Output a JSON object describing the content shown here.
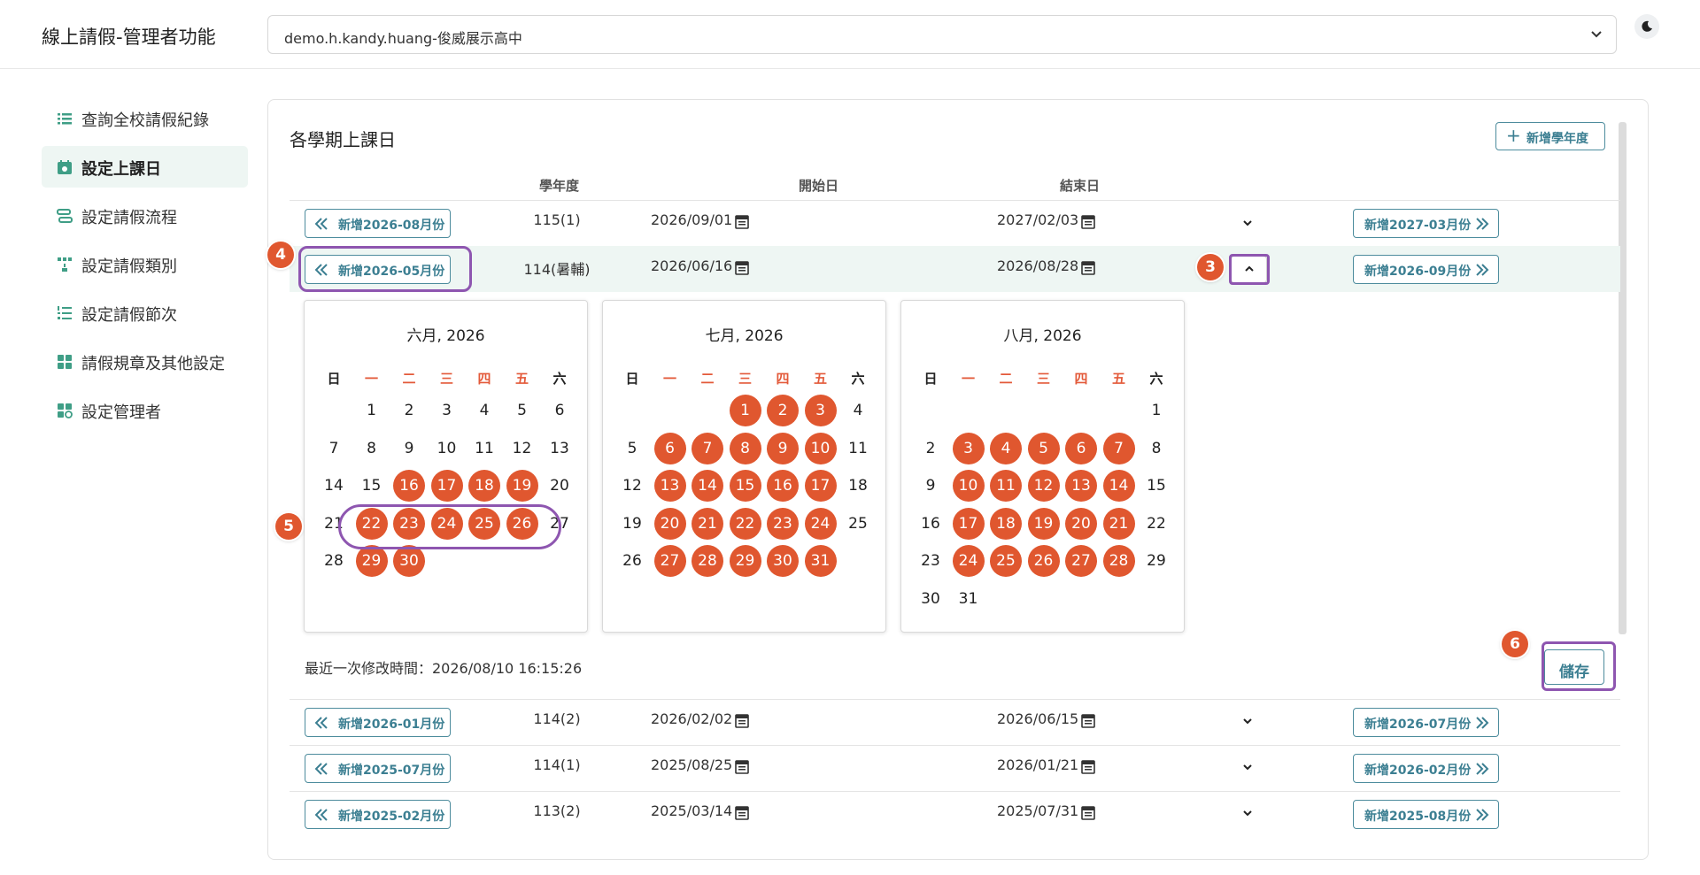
{
  "header": {
    "app_title": "線上請假-管理者功能",
    "school_selected": "demo.h.kandy.huang-俊威展示高中"
  },
  "sidebar": {
    "items": [
      {
        "label": "查詢全校請假紀錄",
        "icon": "list-icon"
      },
      {
        "label": "設定上課日",
        "icon": "calendar-icon",
        "active": true
      },
      {
        "label": "設定請假流程",
        "icon": "flow-icon"
      },
      {
        "label": "設定請假類別",
        "icon": "category-icon"
      },
      {
        "label": "設定請假節次",
        "icon": "numbered-list-icon"
      },
      {
        "label": "請假規章及其他設定",
        "icon": "grid-icon"
      },
      {
        "label": "設定管理者",
        "icon": "admin-icon"
      }
    ]
  },
  "main": {
    "title": "各學期上課日",
    "add_year_label": "新增學年度",
    "columns": [
      "學年度",
      "開始日",
      "結束日"
    ],
    "rows": [
      {
        "prev": "新增2026-08月份",
        "year": "115(1)",
        "start": "2026/09/01",
        "end": "2027/02/03",
        "next": "新增2027-03月份"
      },
      {
        "prev": "新增2026-05月份",
        "year": "114(暑輔)",
        "start": "2026/06/16",
        "end": "2026/08/28",
        "next": "新增2026-09月份",
        "expanded": true
      },
      {
        "prev": "新增2026-01月份",
        "year": "114(2)",
        "start": "2026/02/02",
        "end": "2026/06/15",
        "next": "新增2026-07月份"
      },
      {
        "prev": "新增2025-07月份",
        "year": "114(1)",
        "start": "2025/08/25",
        "end": "2026/01/21",
        "next": "新增2026-02月份"
      },
      {
        "prev": "新增2025-02月份",
        "year": "113(2)",
        "start": "2025/03/14",
        "end": "2025/07/31",
        "next": "新增2025-08月份"
      }
    ],
    "weekdays": [
      "日",
      "一",
      "二",
      "三",
      "四",
      "五",
      "六"
    ],
    "calendars": [
      {
        "title": "六月, 2026",
        "first_weekday": 1,
        "days": 30,
        "selected": [
          16,
          17,
          18,
          19,
          22,
          23,
          24,
          25,
          26,
          29,
          30
        ]
      },
      {
        "title": "七月, 2026",
        "first_weekday": 3,
        "days": 31,
        "selected": [
          1,
          2,
          3,
          6,
          7,
          8,
          9,
          10,
          13,
          14,
          15,
          16,
          17,
          20,
          21,
          22,
          23,
          24,
          27,
          28,
          29,
          30,
          31
        ]
      },
      {
        "title": "八月, 2026",
        "first_weekday": 6,
        "days": 31,
        "selected": [
          3,
          4,
          5,
          6,
          7,
          10,
          11,
          12,
          13,
          14,
          17,
          18,
          19,
          20,
          21,
          24,
          25,
          26,
          27,
          28
        ]
      }
    ],
    "last_modified": "最近一次修改時間：2026/08/10 16:15:26",
    "save_label": "儲存"
  },
  "annotations": [
    "3",
    "4",
    "5",
    "6"
  ],
  "colors": {
    "accent": "#3c7f92",
    "selected_day": "#e0572f",
    "weekday_header": "#e35a3a",
    "highlight_row": "#eef6f3",
    "annotation_outline": "#8e56b0",
    "badge": "#e0572f"
  }
}
